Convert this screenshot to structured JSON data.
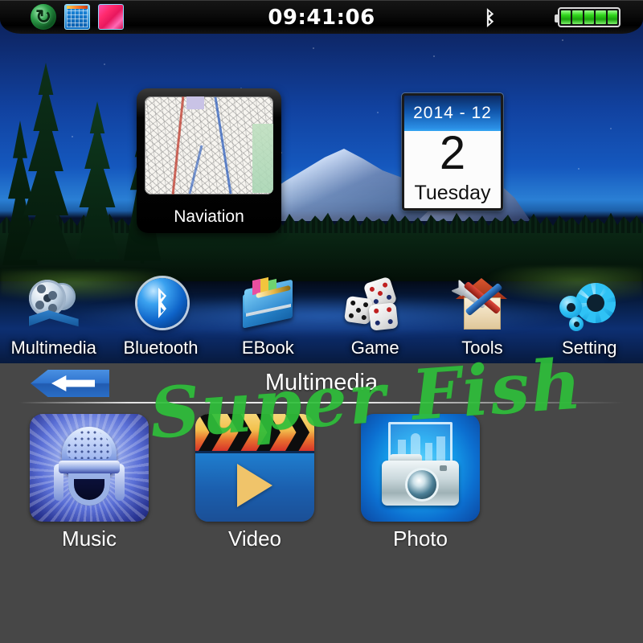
{
  "statusbar": {
    "time": "09:41:06",
    "icons": [
      {
        "name": "sync-icon",
        "glyph": "↻"
      },
      {
        "name": "calendar-grid-icon",
        "glyph": ""
      },
      {
        "name": "pink-gradient-icon",
        "glyph": ""
      }
    ],
    "bluetooth_icon": "bluetooth-icon",
    "battery": {
      "name": "battery-icon",
      "bars": 5,
      "color": "#2fd41a"
    }
  },
  "home": {
    "navigation_tile": {
      "label": "Naviation",
      "icon": "map-icon"
    },
    "calendar_tile": {
      "header": "2014 - 12",
      "day": "2",
      "weekday": "Tuesday"
    },
    "dock": [
      {
        "label": "Multimedia",
        "icon": "film-reel-icon"
      },
      {
        "label": "Bluetooth",
        "icon": "bluetooth-icon"
      },
      {
        "label": "EBook",
        "icon": "book-icon"
      },
      {
        "label": "Game",
        "icon": "dice-icon"
      },
      {
        "label": "Tools",
        "icon": "house-tools-icon"
      },
      {
        "label": "Setting",
        "icon": "gears-icon"
      }
    ]
  },
  "panel": {
    "back_button": "back-arrow-icon",
    "title": "Multimedia",
    "watermark": "Super Fish",
    "watermark_color": "#2fbf3a",
    "apps": [
      {
        "label": "Music",
        "icon": "microphone-icon"
      },
      {
        "label": "Video",
        "icon": "clapperboard-play-icon"
      },
      {
        "label": "Photo",
        "icon": "camera-icon"
      }
    ]
  },
  "colors": {
    "panel_background": "#474747",
    "accent_blue": "#2f74cf",
    "status_background": "#000000"
  }
}
